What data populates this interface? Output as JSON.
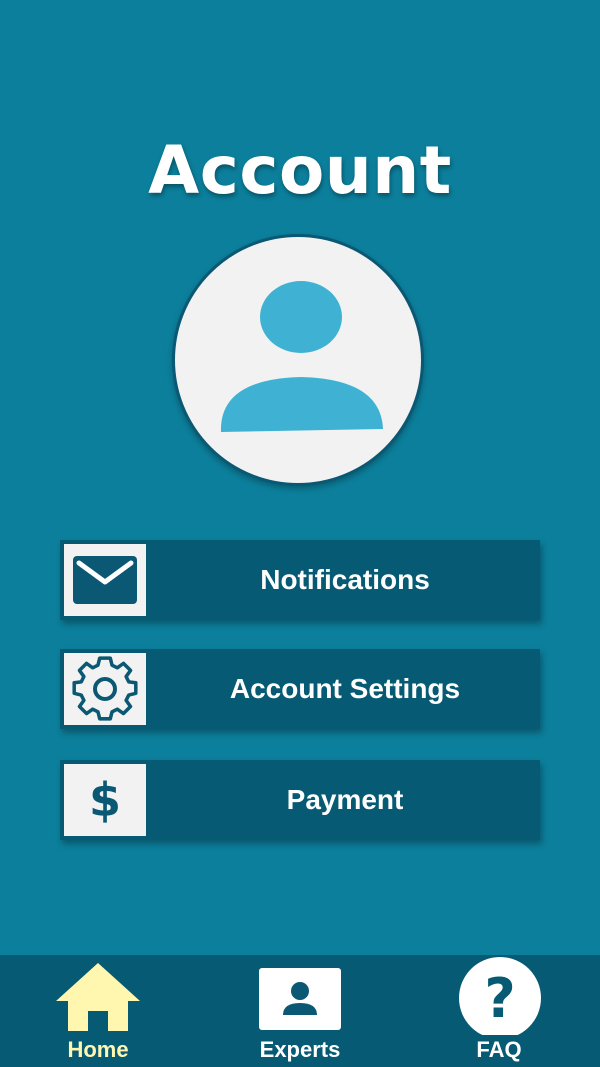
{
  "page": {
    "title": "Account"
  },
  "avatar": {
    "icon": "user-icon"
  },
  "menu": [
    {
      "label": "Notifications",
      "icon": "envelope-icon"
    },
    {
      "label": "Account Settings",
      "icon": "gear-icon"
    },
    {
      "label": "Payment",
      "icon": "dollar-icon",
      "glyph": "$"
    }
  ],
  "bottom_nav": [
    {
      "label": "Home",
      "icon": "home-icon",
      "active": true
    },
    {
      "label": "Experts",
      "icon": "expert-card-icon",
      "active": false
    },
    {
      "label": "FAQ",
      "icon": "question-icon",
      "active": false
    }
  ],
  "colors": {
    "background": "#0c7f9c",
    "bar": "#075a73",
    "accent": "#3fb2d3",
    "active_nav": "#fff6b0",
    "light": "#f2f2f2"
  }
}
